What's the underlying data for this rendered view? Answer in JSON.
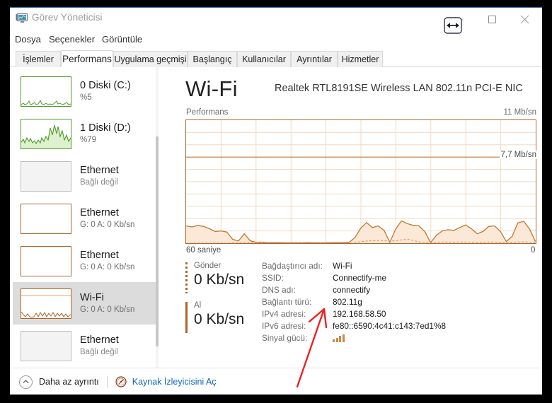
{
  "window": {
    "title": "Görev Yöneticisi",
    "icon": "task-manager-icon",
    "buttons": {
      "minimize": "–",
      "maximize": "□",
      "close": "✕"
    },
    "cursor": "horizontal-resize-cursor"
  },
  "menu": {
    "items": [
      "Dosya",
      "Seçenekler",
      "Görüntüle"
    ]
  },
  "tabs": [
    {
      "label": "İşlemler",
      "active": false
    },
    {
      "label": "Performans",
      "active": true
    },
    {
      "label": "Uygulama geçmişi",
      "active": false
    },
    {
      "label": "Başlangıç",
      "active": false
    },
    {
      "label": "Kullanıcılar",
      "active": false
    },
    {
      "label": "Ayrıntılar",
      "active": false
    },
    {
      "label": "Hizmetler",
      "active": false
    }
  ],
  "sidebar": {
    "items": [
      {
        "title": "0 Diski (C:)",
        "sub": "%5",
        "accent": "#4d9b28",
        "state": "active",
        "selected": false
      },
      {
        "title": "1 Diski (D:)",
        "sub": "%79",
        "accent": "#4d9b28",
        "state": "active",
        "selected": false
      },
      {
        "title": "Ethernet",
        "sub": "Bağlı değil",
        "accent": "#bdbdbd",
        "state": "disconnected",
        "selected": false
      },
      {
        "title": "Ethernet",
        "sub": "G: 0 A: 0 Kb/sn",
        "accent": "#b0642a",
        "state": "idle",
        "selected": false
      },
      {
        "title": "Ethernet",
        "sub": "G: 0 A: 0 Kb/sn",
        "accent": "#b0642a",
        "state": "idle",
        "selected": false
      },
      {
        "title": "Wi-Fi",
        "sub": "G: 0 A: 0 Kb/sn",
        "accent": "#b0642a",
        "state": "active",
        "selected": true
      },
      {
        "title": "Ethernet",
        "sub": "Bağlı değil",
        "accent": "#bdbdbd",
        "state": "disconnected",
        "selected": false
      }
    ],
    "scrollbar": {
      "up_arrow": "⌃",
      "down_arrow": "⌄"
    }
  },
  "main": {
    "title": "Wi-Fi",
    "device": "Realtek RTL8191SE Wireless LAN 802.11n PCI-E NIC",
    "graph_label": "Performans",
    "graph_max_label": "11 Mb/sn",
    "graph_marker_label": "7,7 Mb/sn",
    "axis_left_label": "60 saniye",
    "axis_right_label": "0",
    "accent": "#b0642a",
    "grid_color": "#f0d6bd",
    "fill_color": "#fbe8d7"
  },
  "stats": [
    {
      "name": "Gönder",
      "value": "0 Kb/sn",
      "style": "dashed"
    },
    {
      "name": "Al",
      "value": "0 Kb/sn",
      "style": "solid"
    }
  ],
  "details": [
    {
      "key": "Bağdaştırıcı adı:",
      "value": "Wi-Fi"
    },
    {
      "key": "SSID:",
      "value": "Connectify-me"
    },
    {
      "key": "DNS adı:",
      "value": "connectify"
    },
    {
      "key": "Bağlantı türü:",
      "value": "802.11g"
    },
    {
      "key": "IPv4 adresi:",
      "value": "192.168.58.50"
    },
    {
      "key": "IPv6 adresi:",
      "value": "fe80::6590:4c41:c143:7ed1%8"
    },
    {
      "key": "Sinyal gücü:",
      "value": "",
      "icon": "signal-strength-icon",
      "bars": 4
    }
  ],
  "footer": {
    "less_detail_label": "Daha az ayrıntı",
    "less_detail_icon": "chevron-up-circle-icon",
    "resource_monitor_label": "Kaynak İzleyicisini Aç",
    "resource_monitor_icon": "resource-monitor-icon",
    "link_color": "#1166bb"
  },
  "annotation": {
    "type": "red-arrow",
    "color": "#ee2222",
    "points_to": "IPv4 adresi value",
    "from": [
      420,
      547
    ],
    "to": [
      459,
      436
    ]
  },
  "chart_data": {
    "type": "area",
    "title": "Performans",
    "ylabel": "Mb/sn",
    "xlabel": "saniye",
    "ylim": [
      0,
      11
    ],
    "xlim": [
      60,
      0
    ],
    "grid": true,
    "annotations": [
      "7,7 Mb/sn"
    ],
    "series": [
      {
        "name": "Al",
        "style": "solid",
        "values": [
          1.55,
          1.45,
          1.6,
          1.5,
          1.3,
          1.05,
          1.1,
          0.95,
          0.35,
          0.2,
          0.85,
          0.22,
          0.15,
          0.1,
          0.05,
          0.06,
          0.05,
          0.04,
          0.04,
          0.04,
          0.04,
          0.05,
          0.04,
          0.04,
          0.04,
          0.05,
          0.05,
          0.06,
          0.08,
          0.5,
          1.35,
          1.85,
          1.4,
          1.55,
          1.15,
          0.08,
          1.2,
          2.0,
          1.75,
          1.6,
          1.55,
          1.05,
          0.06,
          0.7,
          1.1,
          1.2,
          1.15,
          1.45,
          1.7,
          1.3,
          0.95,
          1.1,
          1.5,
          1.55,
          1.05,
          0.15,
          0.6,
          1.75,
          1.9,
          1.2,
          0.15
        ]
      },
      {
        "name": "Gönder",
        "style": "dashed",
        "values": [
          0.0,
          0.0,
          0.0,
          0.0,
          0.0,
          0.0,
          0.0,
          0.0,
          0.02,
          0.04,
          0.05,
          0.05,
          0.05,
          0.04,
          0.02,
          0.0,
          0.0,
          0.0,
          0.0,
          0.0,
          0.0,
          0.0,
          0.0,
          0.0,
          0.0,
          0.0,
          0.0,
          0.0,
          0.0,
          0.05,
          0.14,
          0.2,
          0.22,
          0.24,
          0.23,
          0.2,
          0.22,
          0.3,
          0.36,
          0.25,
          0.12,
          0.08,
          0.05,
          0.08,
          0.1,
          0.1,
          0.09,
          0.1,
          0.1,
          0.09,
          0.08,
          0.09,
          0.1,
          0.1,
          0.08,
          0.05,
          0.06,
          0.1,
          0.12,
          0.08,
          0.03
        ]
      }
    ]
  }
}
